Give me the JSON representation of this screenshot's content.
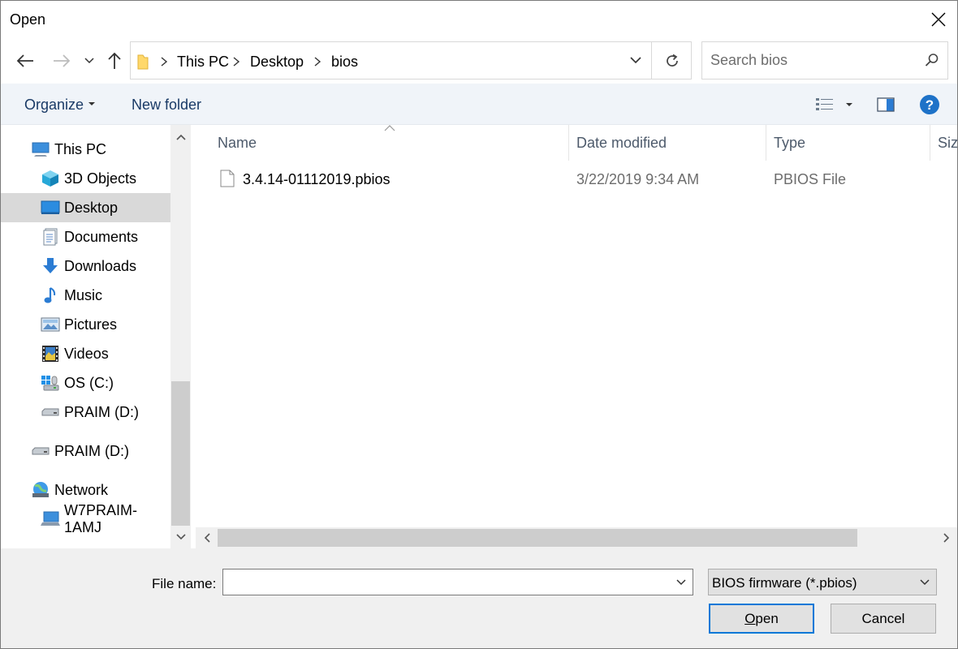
{
  "window": {
    "title": "Open"
  },
  "address": {
    "crumbs": [
      "This PC",
      "Desktop",
      "bios"
    ]
  },
  "search": {
    "placeholder": "Search bios"
  },
  "toolbar": {
    "organize_label": "Organize",
    "new_folder_label": "New folder"
  },
  "nav_pane": {
    "items": [
      {
        "label": "This PC",
        "icon": "computer-icon"
      },
      {
        "label": "3D Objects",
        "icon": "cube-icon"
      },
      {
        "label": "Desktop",
        "icon": "desktop-icon",
        "selected": true
      },
      {
        "label": "Documents",
        "icon": "documents-icon"
      },
      {
        "label": "Downloads",
        "icon": "download-arrow-icon"
      },
      {
        "label": "Music",
        "icon": "music-note-icon"
      },
      {
        "label": "Pictures",
        "icon": "pictures-icon"
      },
      {
        "label": "Videos",
        "icon": "film-icon"
      },
      {
        "label": "OS (C:)",
        "icon": "windows-drive-icon"
      },
      {
        "label": "PRAIM (D:)",
        "icon": "usb-drive-icon"
      },
      {
        "label": "PRAIM (D:)",
        "icon": "usb-drive-icon"
      },
      {
        "label": "Network",
        "icon": "network-globe-icon"
      },
      {
        "label": "W7PRAIM-1AMJ",
        "icon": "network-computer-icon"
      }
    ]
  },
  "file_list": {
    "columns": {
      "name": "Name",
      "date": "Date modified",
      "type": "Type",
      "size": "Size"
    },
    "rows": [
      {
        "name": "3.4.14-01112019.pbios",
        "date": "3/22/2019 9:34 AM",
        "type": "PBIOS File"
      }
    ]
  },
  "footer": {
    "file_name_label": "File name:",
    "file_name_value": "",
    "filter_value": "BIOS firmware (*.pbios)",
    "open_accel": "O",
    "open_rest": "pen",
    "cancel_label": "Cancel"
  },
  "colors": {
    "accent": "#0078d7",
    "selection": "#d9d9d9",
    "toolbar_bg": "#f0f4f9"
  }
}
